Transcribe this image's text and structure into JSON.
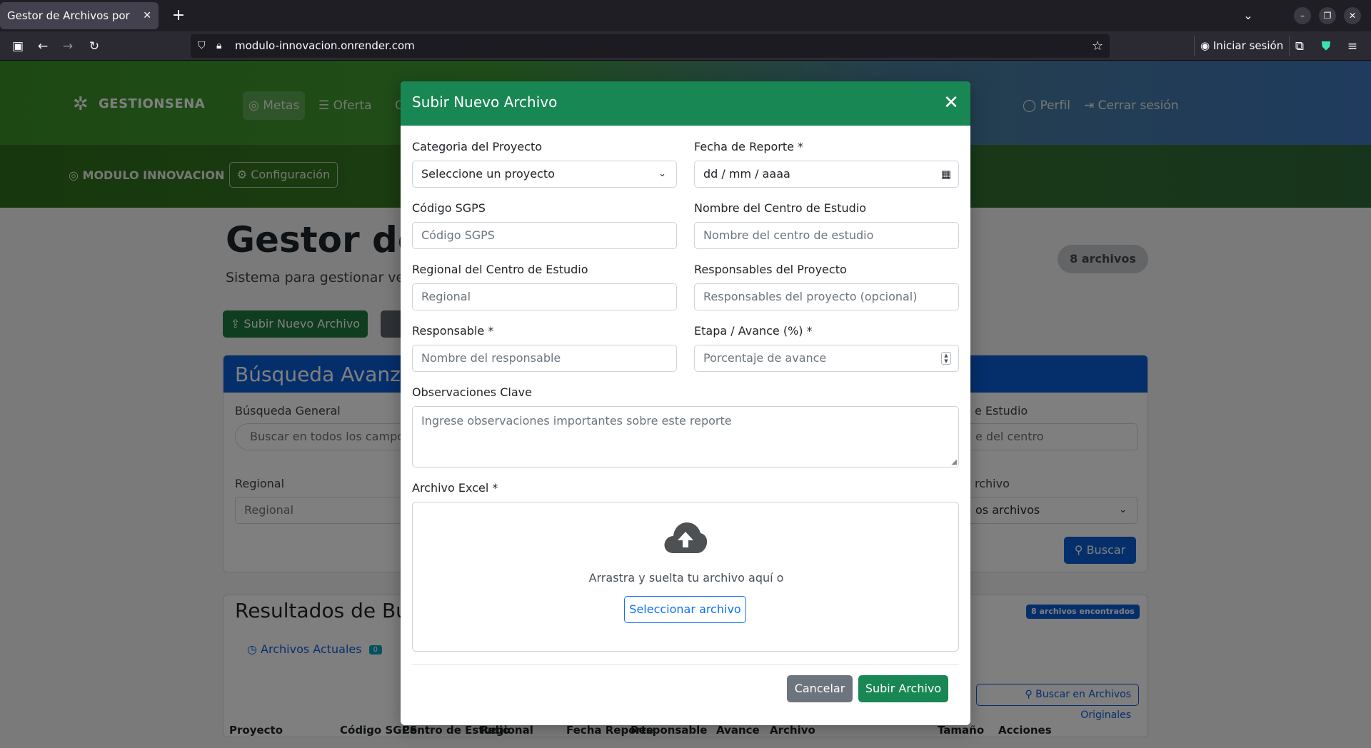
{
  "browser": {
    "tab_title": "Gestor de Archivos por Proye",
    "tab_close": "✕",
    "new_tab": "+",
    "url": "modulo-innovacion.onrender.com",
    "signin_label": "Iniciar sesión"
  },
  "app": {
    "brand": "GESTIONSENA",
    "nav_items": [
      "Metas",
      "Oferta",
      "C"
    ],
    "nav_right": [
      "Perfil",
      "Cerrar sesión"
    ],
    "module_title": "MODULO INNOVACION",
    "config_label": "Configuración",
    "page_title": "Gestor de",
    "page_subtitle": "Sistema para gestionar ve",
    "files_count": "8 archivos",
    "upload_button": "Subir Nuevo Archivo",
    "search_panel": {
      "title": "Búsqueda Avanza",
      "general_label": "Búsqueda General",
      "general_placeholder": "Buscar en todos los campos",
      "regional_label": "Regional",
      "regional_placeholder": "Regional",
      "center_label": "e Estudio",
      "center_placeholder": "e del centro",
      "type_label": "rchivo",
      "type_value": "os archivos",
      "search_button": "Buscar"
    },
    "results_panel": {
      "title": "Resultados de Bús",
      "found_badge": "8 archivos encontrados",
      "tab_current": "Archivos Actuales",
      "tab_current_count": "0",
      "originals_button": "Buscar en Archivos Originales",
      "columns": [
        "Proyecto",
        "Código SGPS",
        "Centro de Estudio",
        "Regional",
        "Fecha Reporte",
        "Responsable",
        "Avance",
        "Archivo",
        "Tamaño",
        "Acciones"
      ]
    }
  },
  "modal": {
    "title": "Subir Nuevo Archivo",
    "close": "✕",
    "fields": {
      "categoria": {
        "label": "Categoria del Proyecto",
        "value": "Seleccione un proyecto"
      },
      "fecha": {
        "label": "Fecha de Reporte *",
        "value": "dd / mm / aaaa"
      },
      "codigo": {
        "label": "Código SGPS",
        "placeholder": "Código SGPS"
      },
      "centro": {
        "label": "Nombre del Centro de Estudio",
        "placeholder": "Nombre del centro de estudio"
      },
      "regional": {
        "label": "Regional del Centro de Estudio",
        "placeholder": "Regional"
      },
      "responsables": {
        "label": "Responsables del Proyecto",
        "placeholder": "Responsables del proyecto (opcional)"
      },
      "responsable": {
        "label": "Responsable *",
        "placeholder": "Nombre del responsable"
      },
      "etapa": {
        "label": "Etapa / Avance (%) *",
        "placeholder": "Porcentaje de avance"
      },
      "observaciones": {
        "label": "Observaciones Clave",
        "placeholder": "Ingrese observaciones importantes sobre este reporte"
      },
      "archivo": {
        "label": "Archivo Excel *",
        "drop_text": "Arrastra y suelta tu archivo aquí o",
        "select_button": "Seleccionar archivo"
      }
    },
    "cancel_button": "Cancelar",
    "submit_button": "Subir Archivo"
  },
  "colors": {
    "modal_header": "#198754",
    "primary": "#0d6efd",
    "secondary": "#6c757d"
  }
}
